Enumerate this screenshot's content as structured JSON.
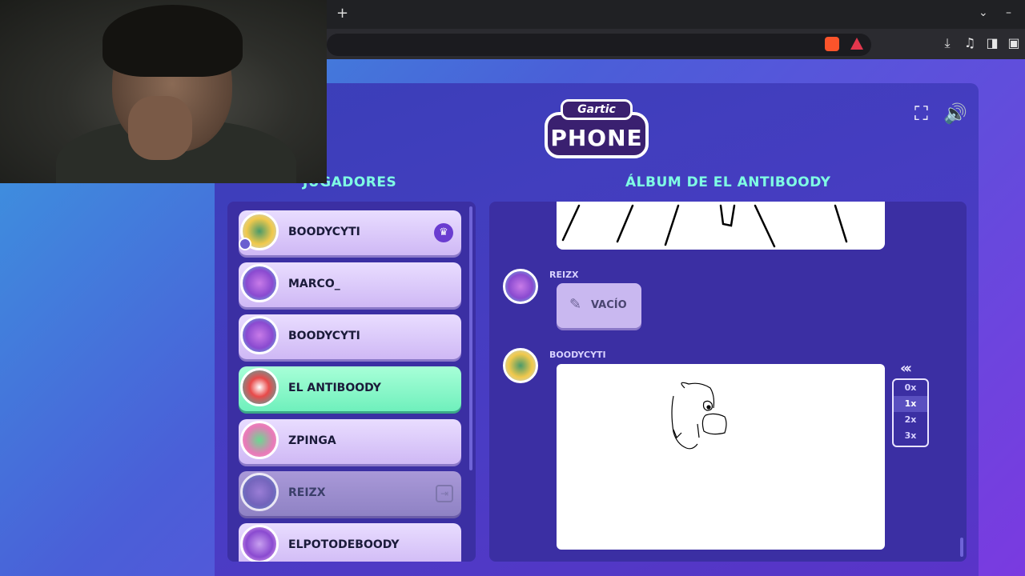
{
  "browser": {
    "new_tab_icon": "+",
    "chevron_icon": "⌄",
    "minimize_icon": "–"
  },
  "game": {
    "logo_top": "Gartic",
    "logo_main": "PHONE",
    "players_title": "JUGADORES",
    "album_title": "ÁLBUM DE EL ANTIBOODY"
  },
  "players": [
    {
      "name": "BOODYCYTI",
      "host": true
    },
    {
      "name": "MARCO_"
    },
    {
      "name": "BOODYCYTI"
    },
    {
      "name": "EL ANTIBOODY",
      "active": true
    },
    {
      "name": "ZPINGA"
    },
    {
      "name": "REIZX",
      "left": true
    },
    {
      "name": "ELPOTODEBOODY"
    }
  ],
  "album": {
    "messages": [
      {
        "author": "REIZX",
        "content": "VACÍO"
      },
      {
        "author": "BOODYCYTI"
      }
    ],
    "speed_options": [
      "0x",
      "1x",
      "2x",
      "3x"
    ],
    "speed_selected": "1x"
  },
  "colors": {
    "accent_title": "#7fffe4",
    "active_player": "#6ff0bc",
    "panel": "#3b2fa3"
  }
}
